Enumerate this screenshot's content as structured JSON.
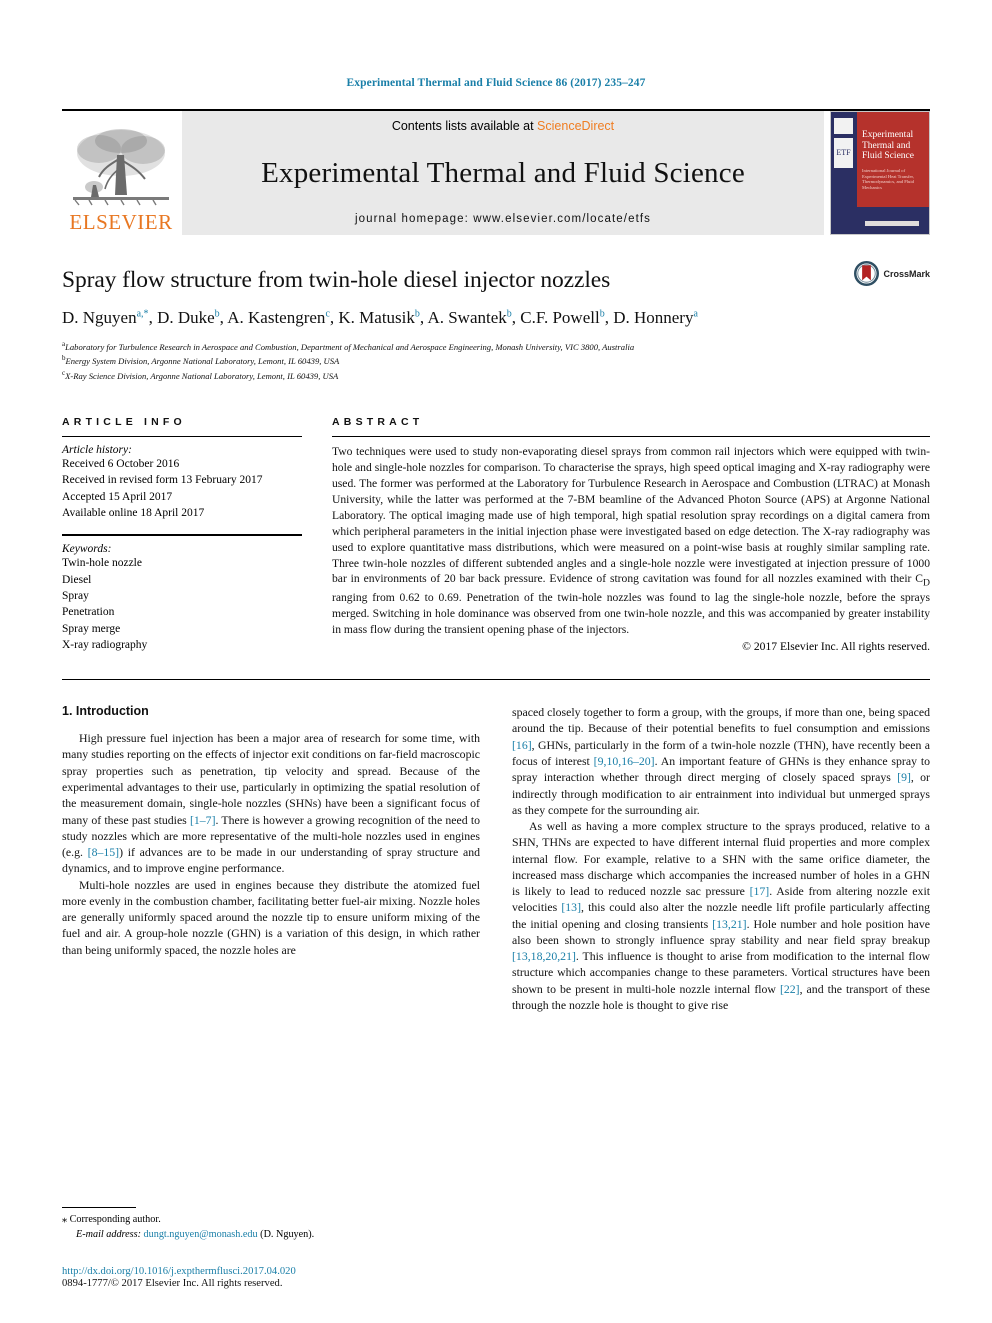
{
  "running_head": "Experimental Thermal and Fluid Science 86 (2017) 235–247",
  "masthead": {
    "contents_prefix": "Contents lists available at",
    "sciencedirect": "ScienceDirect",
    "journal_name": "Experimental Thermal and Fluid Science",
    "homepage": "journal homepage: www.elsevier.com/locate/etfs",
    "publisher_wordmark": "ELSEVIER",
    "cover_title": "Experimental Thermal and Fluid Science",
    "cover_subtitle": "International Journal of Experimental Heat Transfer, Thermodynamics, and Fluid Mechanics",
    "cover_badge_label": "ETF",
    "accent_orange": "#e87722",
    "accent_blue": "#1a7fa8",
    "cover_red": "#b5322c",
    "cover_navy": "#2b2f63"
  },
  "title": "Spray flow structure from twin-hole diesel injector nozzles",
  "crossmark_label": "CrossMark",
  "authors_html": "D. Nguyen<sup>a,*</sup>, D. Duke<sup>b</sup>, A. Kastengren<sup>c</sup>, K. Matusik<sup>b</sup>, A. Swantek<sup>b</sup>, C.F. Powell<sup>b</sup>, D. Honnery<sup>a</sup>",
  "affiliations": [
    "Laboratory for Turbulence Research in Aerospace and Combustion, Department of Mechanical and Aerospace Engineering, Monash University, VIC 3800, Australia",
    "Energy System Division, Argonne National Laboratory, Lemont, IL 60439, USA",
    "X-Ray Science Division, Argonne National Laboratory, Lemont, IL 60439, USA"
  ],
  "affiliation_marks": [
    "a",
    "b",
    "c"
  ],
  "article_info": {
    "heading": "ARTICLE INFO",
    "history_label": "Article history:",
    "history": [
      "Received 6 October 2016",
      "Received in revised form 13 February 2017",
      "Accepted 15 April 2017",
      "Available online 18 April 2017"
    ],
    "keywords_label": "Keywords:",
    "keywords": [
      "Twin-hole nozzle",
      "Diesel",
      "Spray",
      "Penetration",
      "Spray merge",
      "X-ray radiography"
    ]
  },
  "abstract": {
    "heading": "ABSTRACT",
    "text_part1": "Two techniques were used to study non-evaporating diesel sprays from common rail injectors which were equipped with twin-hole and single-hole nozzles for comparison. To characterise the sprays, high speed optical imaging and X-ray radiography were used. The former was performed at the Laboratory for Turbulence Research in Aerospace and Combustion (LTRAC) at Monash University, while the latter was performed at the 7-BM beamline of the Advanced Photon Source (APS) at Argonne National Laboratory. The optical imaging made use of high temporal, high spatial resolution spray recordings on a digital camera from which peripheral parameters in the initial injection phase were investigated based on edge detection. The X-ray radiography was used to explore quantitative mass distributions, which were measured on a point-wise basis at roughly similar sampling rate. Three twin-hole nozzles of different subtended angles and a single-hole nozzle were investigated at injection pressure of 1000 bar in environments of 20 bar back pressure. Evidence of strong cavitation was found for all nozzles examined with their C",
    "cd_subscript": "D",
    "text_part2": " ranging from 0.62 to 0.69. Penetration of the twin-hole nozzles was found to lag the single-hole nozzle, before the sprays merged. Switching in hole dominance was observed from one twin-hole nozzle, and this was accompanied by greater instability in mass flow during the transient opening phase of the injectors.",
    "copyright": "© 2017 Elsevier Inc. All rights reserved."
  },
  "body": {
    "section_title": "1. Introduction",
    "left_paragraphs": [
      "High pressure fuel injection has been a major area of research for some time, with many studies reporting on the effects of injector exit conditions on far-field macroscopic spray properties such as penetration, tip velocity and spread. Because of the experimental advantages to their use, particularly in optimizing the spatial resolution of the measurement domain, single-hole nozzles (SHNs) have been a significant focus of many of these past studies [1–7]. There is however a growing recognition of the need to study nozzles which are more representative of the multi-hole nozzles used in engines (e.g. [8–15]) if advances are to be made in our understanding of spray structure and dynamics, and to improve engine performance.",
      "Multi-hole nozzles are used in engines because they distribute the atomized fuel more evenly in the combustion chamber, facilitating better fuel-air mixing. Nozzle holes are generally uniformly spaced around the nozzle tip to ensure uniform mixing of the fuel and air. A group-hole nozzle (GHN) is a variation of this design, in which rather than being uniformly spaced, the nozzle holes are"
    ],
    "right_paragraphs": [
      "spaced closely together to form a group, with the groups, if more than one, being spaced around the tip. Because of their potential benefits to fuel consumption and emissions [16], GHNs, particularly in the form of a twin-hole nozzle (THN), have recently been a focus of interest [9,10,16–20]. An important feature of GHNs is they enhance spray to spray interaction whether through direct merging of closely spaced sprays [9], or indirectly through modification to air entrainment into individual but unmerged sprays as they compete for the surrounding air.",
      "As well as having a more complex structure to the sprays produced, relative to a SHN, THNs are expected to have different internal fluid properties and more complex internal flow. For example, relative to a SHN with the same orifice diameter, the increased mass discharge which accompanies the increased number of holes in a GHN is likely to lead to reduced nozzle sac pressure [17]. Aside from altering nozzle exit velocities [13], this could also alter the nozzle needle lift profile particularly affecting the initial opening and closing transients [13,21]. Hole number and hole position have also been shown to strongly influence spray stability and near field spray breakup [13,18,20,21]. This influence is thought to arise from modification to the internal flow structure which accompanies change to these parameters. Vortical structures have been shown to be present in multi-hole nozzle internal flow [22], and the transport of these through the nozzle hole is thought to give rise"
    ],
    "citation_color": "#1a7fa8"
  },
  "footnotes": {
    "corresponding_marker": "⁎",
    "corresponding_text": "Corresponding author.",
    "email_label": "E-mail address:",
    "email": "dungt.nguyen@monash.edu",
    "email_suffix": "(D. Nguyen).",
    "doi": "http://dx.doi.org/10.1016/j.expthermflusci.2017.04.020",
    "issn_line": "0894-1777/© 2017 Elsevier Inc. All rights reserved."
  }
}
